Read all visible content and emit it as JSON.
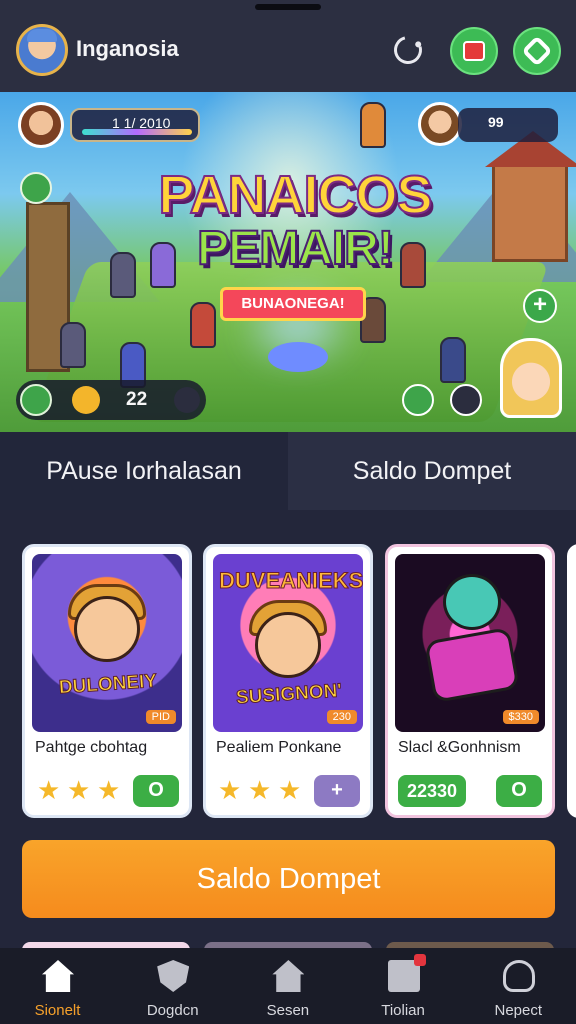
{
  "header": {
    "username": "Inganosia"
  },
  "banner": {
    "hud_left_text": "1 1/ 2010",
    "hud_right_text": "99",
    "title_line1": "PANAICOS",
    "title_line2": "PEMAIR!",
    "ribbon_text": "BUNAONEGA!",
    "hud_bottom_value": "22"
  },
  "tabs": [
    {
      "label": "PAuse Iorhalasan"
    },
    {
      "label": "Saldo Dompet"
    }
  ],
  "cards": [
    {
      "title": "Pahtge cbohtag",
      "art_caption": "DULONEIY",
      "art_price": "PID",
      "stars": 3,
      "button": "O"
    },
    {
      "title": "Pealiem Ponkane",
      "art_caption_top": "DUVEANIEKS",
      "art_caption": "SUSIGNON'",
      "art_price": "230",
      "stars": 3,
      "button": "+"
    },
    {
      "title": "Slacl &Gonhnism",
      "art_price": "$330",
      "price": "22330",
      "button": "O"
    }
  ],
  "cta": {
    "label": "Saldo Dompet"
  },
  "bottom_nav": [
    {
      "label": "Sionelt",
      "icon": "home-icon",
      "active": true
    },
    {
      "label": "Dogdcn",
      "icon": "shield-icon",
      "active": false
    },
    {
      "label": "Sesen",
      "icon": "house-icon",
      "active": false
    },
    {
      "label": "Tiolian",
      "icon": "document-icon",
      "active": false
    },
    {
      "label": "Nepect",
      "icon": "user-icon",
      "active": false
    }
  ],
  "colors": {
    "accent": "#f6a12b",
    "green": "#3cae45",
    "background": "#23263a"
  }
}
